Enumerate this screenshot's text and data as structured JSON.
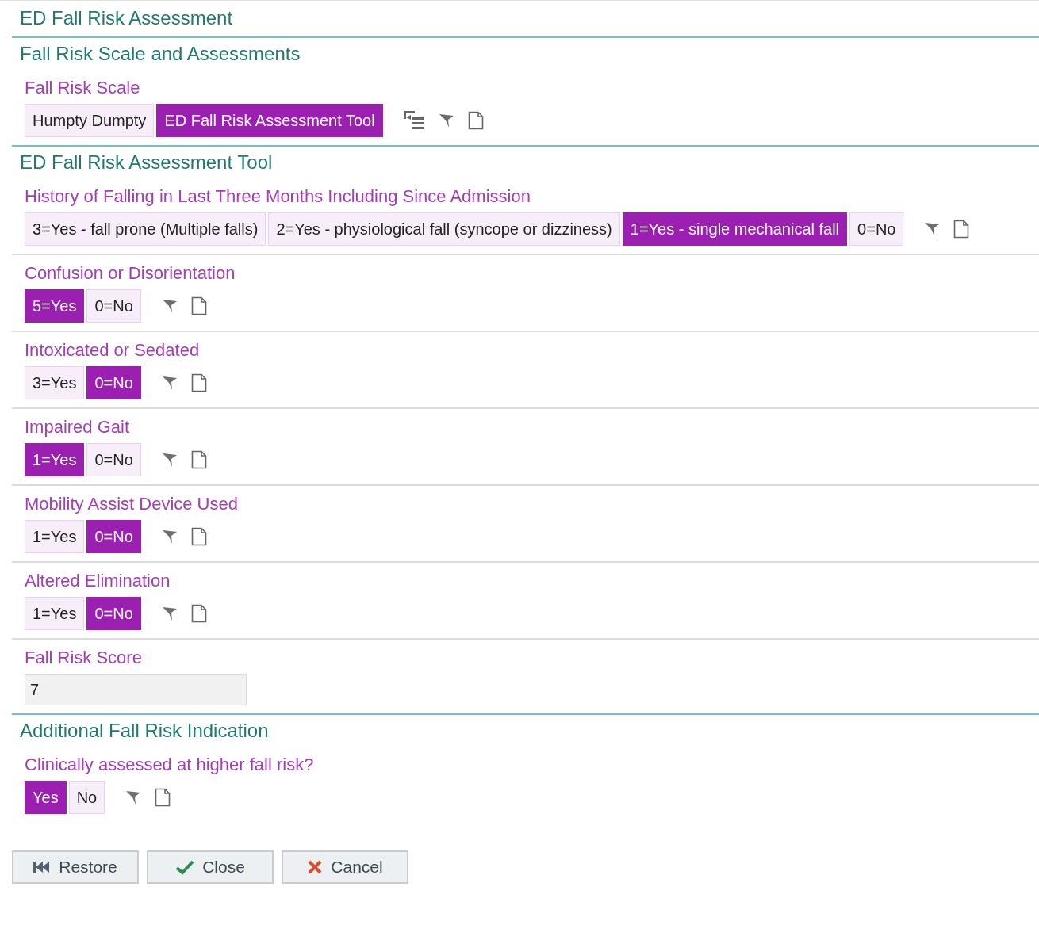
{
  "title": "ED Fall Risk Assessment",
  "sections": [
    {
      "heading": "Fall Risk Scale and Assessments",
      "questions": [
        {
          "kind": "scale",
          "label": "Fall Risk Scale",
          "options": [
            {
              "label": "Humpty Dumpty",
              "selected": false
            },
            {
              "label": "ED Fall Risk Assessment Tool",
              "selected": true
            }
          ]
        }
      ]
    },
    {
      "heading": "ED Fall Risk Assessment Tool",
      "questions": [
        {
          "kind": "choice",
          "label": "History of Falling in Last Three Months Including Since Admission",
          "options": [
            {
              "label": "3=Yes - fall prone (Multiple falls)",
              "selected": false
            },
            {
              "label": "2=Yes - physiological fall (syncope or dizziness)",
              "selected": false
            },
            {
              "label": "1=Yes - single mechanical fall",
              "selected": true
            },
            {
              "label": "0=No",
              "selected": false
            }
          ]
        },
        {
          "kind": "choice",
          "label": "Confusion or Disorientation",
          "options": [
            {
              "label": "5=Yes",
              "selected": true
            },
            {
              "label": "0=No",
              "selected": false
            }
          ]
        },
        {
          "kind": "choice",
          "label": "Intoxicated or Sedated",
          "options": [
            {
              "label": "3=Yes",
              "selected": false
            },
            {
              "label": "0=No",
              "selected": true
            }
          ]
        },
        {
          "kind": "choice",
          "label": "Impaired Gait",
          "options": [
            {
              "label": "1=Yes",
              "selected": true
            },
            {
              "label": "0=No",
              "selected": false
            }
          ]
        },
        {
          "kind": "choice",
          "label": "Mobility Assist Device Used",
          "options": [
            {
              "label": "1=Yes",
              "selected": false
            },
            {
              "label": "0=No",
              "selected": true
            }
          ]
        },
        {
          "kind": "choice",
          "label": "Altered Elimination",
          "options": [
            {
              "label": "1=Yes",
              "selected": false
            },
            {
              "label": "0=No",
              "selected": true
            }
          ]
        },
        {
          "kind": "field",
          "label": "Fall Risk Score",
          "value": "7"
        }
      ]
    },
    {
      "heading": "Additional Fall Risk Indication",
      "questions": [
        {
          "kind": "choice",
          "label": "Clinically assessed at higher fall risk?",
          "options": [
            {
              "label": "Yes",
              "selected": true
            },
            {
              "label": "No",
              "selected": false
            }
          ]
        }
      ]
    }
  ],
  "buttons": [
    {
      "kind": "restore",
      "label": "Restore"
    },
    {
      "kind": "close",
      "label": "Close"
    },
    {
      "kind": "cancel",
      "label": "Cancel"
    }
  ]
}
